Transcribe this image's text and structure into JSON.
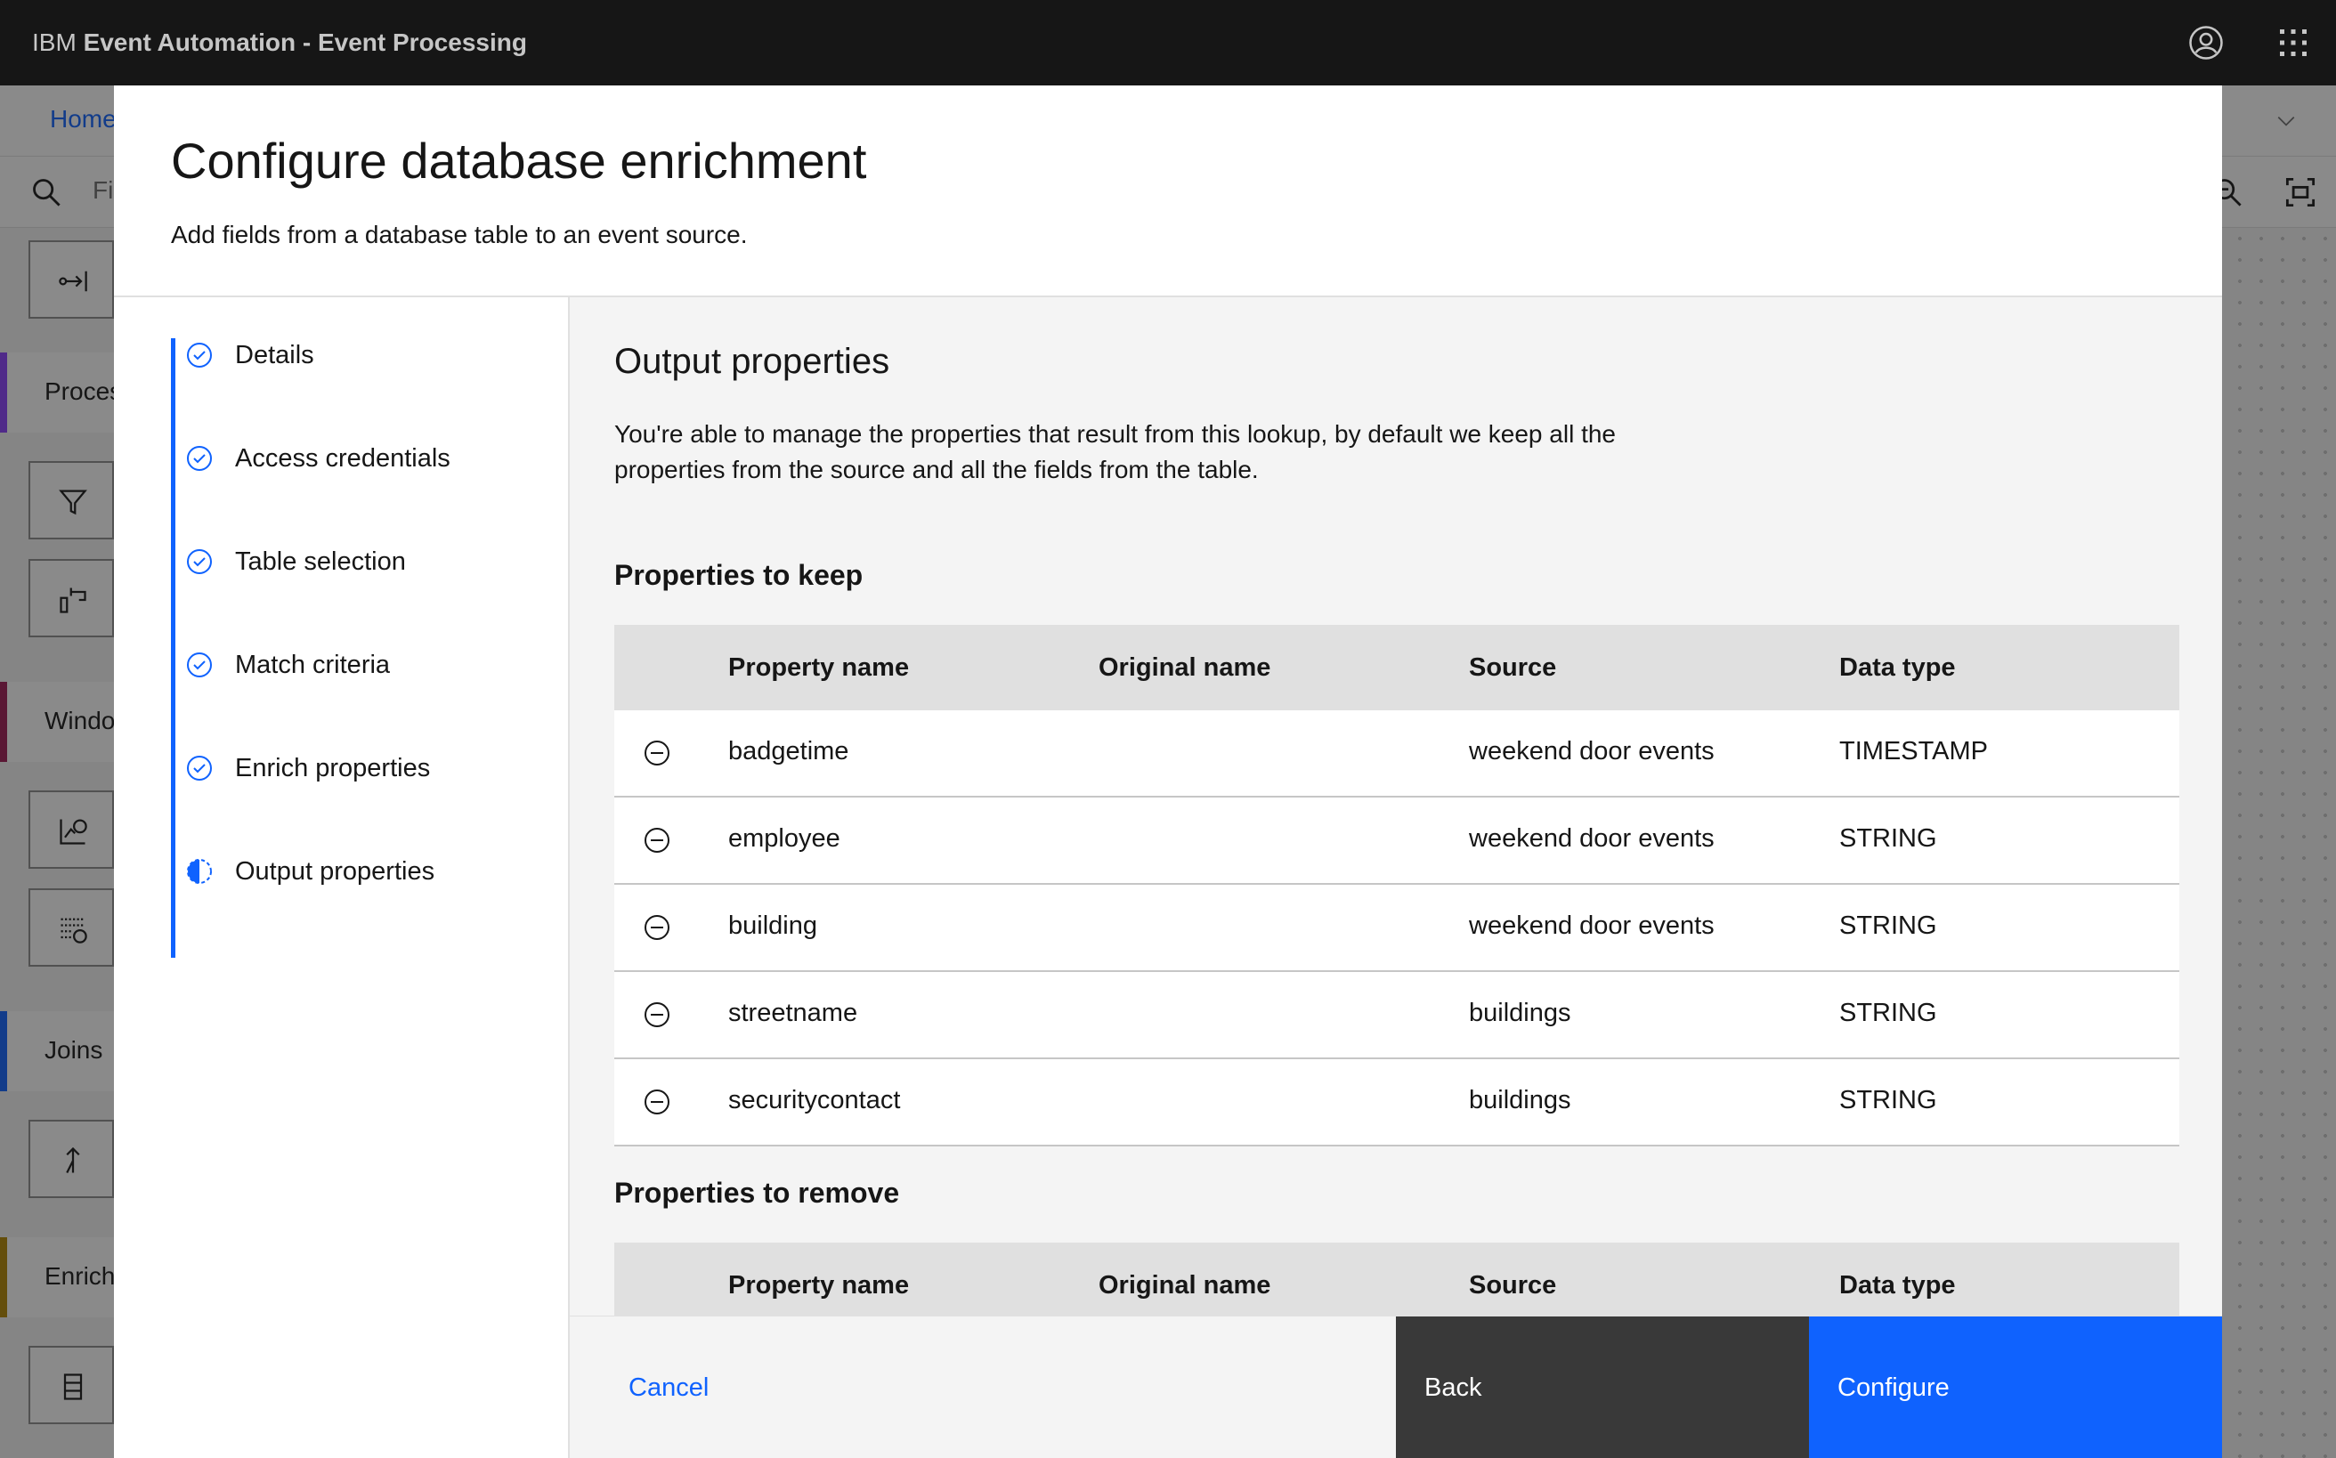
{
  "header": {
    "brand_prefix": "IBM",
    "brand_product": "Event Automation - Event Processing"
  },
  "background": {
    "breadcrumb_home": "Home",
    "search_placeholder": "Fi",
    "palette_categories": [
      "Proces",
      "Windo",
      "Joins",
      "Enrich"
    ]
  },
  "modal": {
    "title": "Configure database enrichment",
    "subtitle": "Add fields from a database table to an event source.",
    "steps": [
      {
        "label": "Details",
        "state": "complete"
      },
      {
        "label": "Access credentials",
        "state": "complete"
      },
      {
        "label": "Table selection",
        "state": "complete"
      },
      {
        "label": "Match criteria",
        "state": "complete"
      },
      {
        "label": "Enrich properties",
        "state": "complete"
      },
      {
        "label": "Output properties",
        "state": "current"
      }
    ],
    "section_title": "Output properties",
    "section_desc": "You're able to manage the properties that result from this lookup, by default we keep all the properties from the source and all the fields from the table.",
    "keep_title": "Properties to keep",
    "remove_title": "Properties to remove",
    "columns": [
      "Property name",
      "Original name",
      "Source",
      "Data type"
    ],
    "keep_rows": [
      {
        "property": "badgetime",
        "original": "",
        "source": "weekend door events",
        "type": "TIMESTAMP"
      },
      {
        "property": "employee",
        "original": "",
        "source": "weekend door events",
        "type": "STRING"
      },
      {
        "property": "building",
        "original": "",
        "source": "weekend door events",
        "type": "STRING"
      },
      {
        "property": "streetname",
        "original": "",
        "source": "buildings",
        "type": "STRING"
      },
      {
        "property": "securitycontact",
        "original": "",
        "source": "buildings",
        "type": "STRING"
      }
    ],
    "buttons": {
      "cancel": "Cancel",
      "back": "Back",
      "configure": "Configure"
    }
  },
  "colors": {
    "accent": "#0f62fe",
    "header_bg": "#161616",
    "back_button": "#393939"
  }
}
